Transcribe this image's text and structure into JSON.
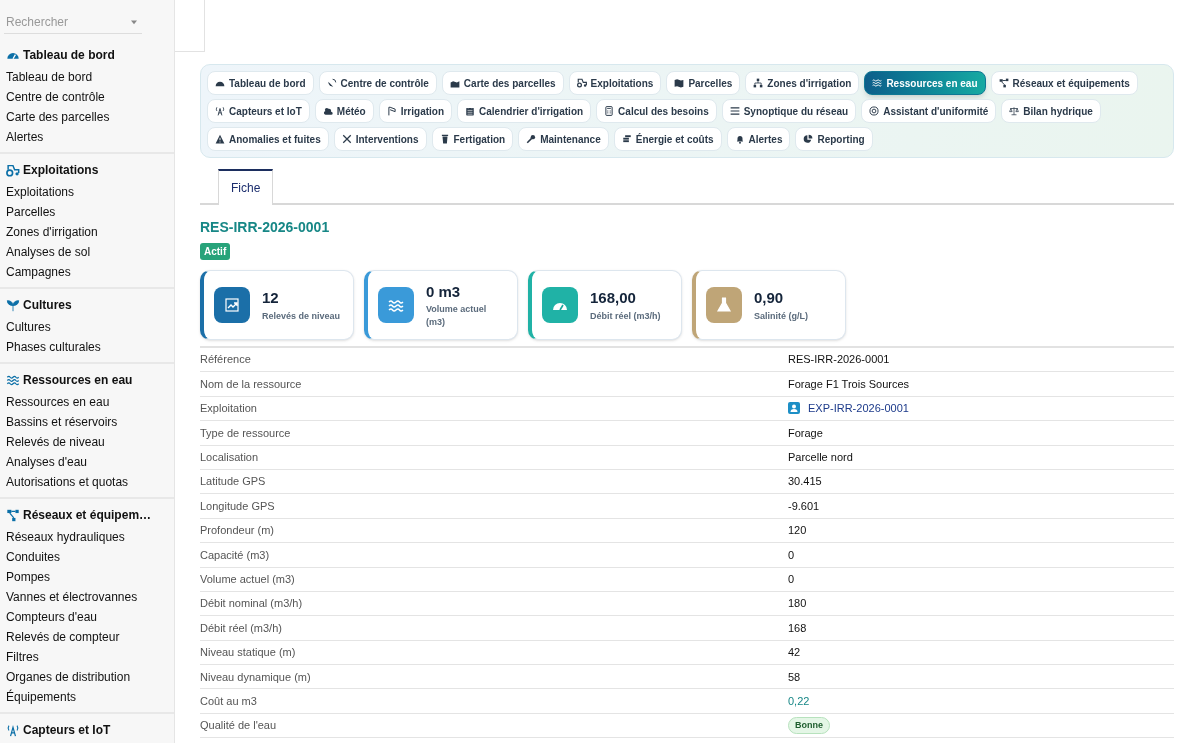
{
  "sidebar": {
    "search": {
      "placeholder": "Rechercher"
    },
    "sections": [
      {
        "title": "Tableau de bord",
        "items": [
          "Tableau de bord",
          "Centre de contrôle",
          "Carte des parcelles",
          "Alertes"
        ]
      },
      {
        "title": "Exploitations",
        "items": [
          "Exploitations",
          "Parcelles",
          "Zones d'irrigation",
          "Analyses de sol",
          "Campagnes"
        ]
      },
      {
        "title": "Cultures",
        "items": [
          "Cultures",
          "Phases culturales"
        ]
      },
      {
        "title": "Ressources en eau",
        "items": [
          "Ressources en eau",
          "Bassins et réservoirs",
          "Relevés de niveau",
          "Analyses d'eau",
          "Autorisations et quotas"
        ]
      },
      {
        "title": "Réseaux et équipem…",
        "items": [
          "Réseaux hydrauliques",
          "Conduites",
          "Pompes",
          "Vannes et électrovannes",
          "Compteurs d'eau",
          "Relevés de compteur",
          "Filtres",
          "Organes de distribution",
          "Équipements"
        ]
      },
      {
        "title": "Capteurs et IoT"
      }
    ]
  },
  "module_nav": [
    {
      "label": "Tableau de bord",
      "selected": false
    },
    {
      "label": "Centre de contrôle",
      "selected": false
    },
    {
      "label": "Carte des parcelles",
      "selected": false
    },
    {
      "label": "Exploitations",
      "selected": false
    },
    {
      "label": "Parcelles",
      "selected": false
    },
    {
      "label": "Zones d'irrigation",
      "selected": false
    },
    {
      "label": "Ressources en eau",
      "selected": true
    },
    {
      "label": "Réseaux et équipements",
      "selected": false
    },
    {
      "label": "Capteurs et IoT",
      "selected": false
    },
    {
      "label": "Météo",
      "selected": false
    },
    {
      "label": "Irrigation",
      "selected": false
    },
    {
      "label": "Calendrier d'irrigation",
      "selected": false
    },
    {
      "label": "Calcul des besoins",
      "selected": false
    },
    {
      "label": "Synoptique du réseau",
      "selected": false
    },
    {
      "label": "Assistant d'uniformité",
      "selected": false
    },
    {
      "label": "Bilan hydrique",
      "selected": false
    },
    {
      "label": "Anomalies et fuites",
      "selected": false
    },
    {
      "label": "Interventions",
      "selected": false
    },
    {
      "label": "Fertigation",
      "selected": false
    },
    {
      "label": "Maintenance",
      "selected": false
    },
    {
      "label": "Énergie et coûts",
      "selected": false
    },
    {
      "label": "Alertes",
      "selected": false
    },
    {
      "label": "Reporting",
      "selected": false
    }
  ],
  "tabs": [
    {
      "label": "Fiche",
      "selected": true
    }
  ],
  "record": {
    "title": "RES-IRR-2026-0001",
    "status": "Actif"
  },
  "stats": [
    {
      "value": "12",
      "label": "Relevés de niveau",
      "color": "#1b6fa8"
    },
    {
      "value": "0 m3",
      "label": "Volume actuel (m3)",
      "color": "#3a9ad9"
    },
    {
      "value": "168,00",
      "label": "Débit réel (m3/h)",
      "color": "#20b2a6"
    },
    {
      "value": "0,90",
      "label": "Salinité (g/L)",
      "color": "#bfa577"
    }
  ],
  "fields": [
    {
      "label": "Référence",
      "value": "RES-IRR-2026-0001",
      "kind": "text"
    },
    {
      "label": "Nom de la ressource",
      "value": "Forage F1 Trois Sources",
      "kind": "text"
    },
    {
      "label": "Exploitation",
      "value": "EXP-IRR-2026-0001",
      "kind": "link"
    },
    {
      "label": "Type de ressource",
      "value": "Forage",
      "kind": "text"
    },
    {
      "label": "Localisation",
      "value": "Parcelle nord",
      "kind": "text"
    },
    {
      "label": "Latitude GPS",
      "value": "30.415",
      "kind": "text"
    },
    {
      "label": "Longitude GPS",
      "value": "-9.601",
      "kind": "text"
    },
    {
      "label": "Profondeur (m)",
      "value": "120",
      "kind": "text"
    },
    {
      "label": "Capacité (m3)",
      "value": "0",
      "kind": "text"
    },
    {
      "label": "Volume actuel (m3)",
      "value": "0",
      "kind": "text"
    },
    {
      "label": "Débit nominal (m3/h)",
      "value": "180",
      "kind": "text"
    },
    {
      "label": "Débit réel (m3/h)",
      "value": "168",
      "kind": "text"
    },
    {
      "label": "Niveau statique (m)",
      "value": "42",
      "kind": "text"
    },
    {
      "label": "Niveau dynamique (m)",
      "value": "58",
      "kind": "text"
    },
    {
      "label": "Coût au m3",
      "value": "0,22",
      "kind": "accent"
    },
    {
      "label": "Qualité de l'eau",
      "value": "Bonne",
      "kind": "badge"
    }
  ]
}
